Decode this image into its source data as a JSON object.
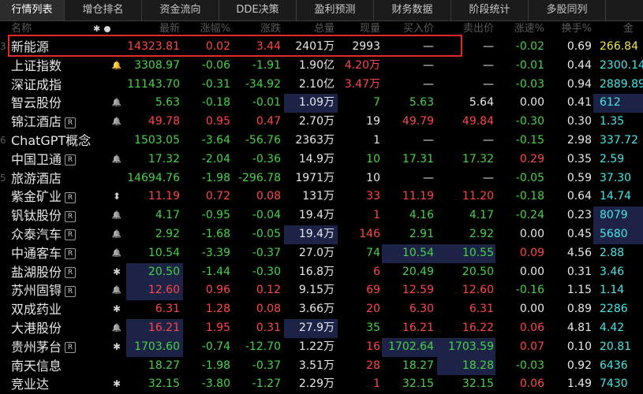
{
  "tabs": [
    "行情列表",
    "增仓排名",
    "资金流向",
    "DDE决策",
    "盈利预测",
    "财务数据",
    "阶段统计",
    "多股同列"
  ],
  "headers": [
    "名称",
    "最新",
    "涨幅%",
    "涨跌",
    "总量",
    "现量",
    "买入价",
    "卖出价",
    "涨速%",
    "换手%",
    "金"
  ],
  "rows": [
    {
      "idx": "3",
      "name": "新能源",
      "badge": "",
      "mark": "",
      "price": "14323.81",
      "pct": "0.02",
      "chg": "3.44",
      "vol": "2401万",
      "cur": "2993",
      "bid": "—",
      "ask": "—",
      "speed": "-0.02",
      "turn": "0.69",
      "amt": "266.84",
      "c": [
        "red",
        "red",
        "red",
        "white",
        "white",
        "white",
        "white",
        "green",
        "white",
        "yellow"
      ],
      "bg": []
    },
    {
      "idx": "",
      "name": "上证指数",
      "badge": "",
      "mark": "bell-red",
      "price": "3308.97",
      "pct": "-0.06",
      "chg": "-1.91",
      "vol": "1.90亿",
      "cur": "4.20万",
      "bid": "—",
      "ask": "—",
      "speed": "-0.01",
      "turn": "0.44",
      "amt": "2300.14",
      "c": [
        "green",
        "green",
        "green",
        "white",
        "red",
        "white",
        "white",
        "green",
        "white",
        "cyan"
      ],
      "bg": []
    },
    {
      "idx": "",
      "name": "深证成指",
      "badge": "",
      "mark": "",
      "price": "11143.70",
      "pct": "-0.31",
      "chg": "-34.92",
      "vol": "2.10亿",
      "cur": "3.47万",
      "bid": "—",
      "ask": "—",
      "speed": "-0.03",
      "turn": "0.94",
      "amt": "2889.89",
      "c": [
        "green",
        "green",
        "green",
        "white",
        "red",
        "white",
        "white",
        "green",
        "white",
        "cyan"
      ],
      "bg": []
    },
    {
      "idx": "",
      "name": "智云股份",
      "badge": "",
      "mark": "bell",
      "price": "5.63",
      "pct": "-0.18",
      "chg": "-0.01",
      "vol": "1.09万",
      "cur": "7",
      "bid": "5.63",
      "ask": "5.64",
      "speed": "0.00",
      "turn": "0.41",
      "amt": "612",
      "c": [
        "green",
        "green",
        "green",
        "white",
        "green",
        "green",
        "white",
        "white",
        "white",
        "cyan"
      ],
      "bg": [
        "vol",
        "amt"
      ]
    },
    {
      "idx": "",
      "name": "锦江酒店",
      "badge": "R",
      "mark": "bell",
      "price": "49.78",
      "pct": "0.95",
      "chg": "0.47",
      "vol": "2.70万",
      "cur": "19",
      "bid": "49.79",
      "ask": "49.84",
      "speed": "-0.30",
      "turn": "0.30",
      "amt": "1.35",
      "c": [
        "red",
        "red",
        "red",
        "white",
        "white",
        "red",
        "red",
        "green",
        "white",
        "cyan"
      ],
      "bg": []
    },
    {
      "idx": "6",
      "name": "ChatGPT概念",
      "badge": "",
      "mark": "",
      "price": "1503.05",
      "pct": "-3.64",
      "chg": "-56.76",
      "vol": "2363万",
      "cur": "1",
      "bid": "—",
      "ask": "—",
      "speed": "-0.15",
      "turn": "2.98",
      "amt": "337.72",
      "c": [
        "green",
        "green",
        "green",
        "white",
        "white",
        "white",
        "white",
        "green",
        "white",
        "cyan"
      ],
      "bg": []
    },
    {
      "idx": "",
      "name": "中国卫通",
      "badge": "R",
      "mark": "bell",
      "price": "17.32",
      "pct": "-2.04",
      "chg": "-0.36",
      "vol": "14.9万",
      "cur": "10",
      "bid": "17.31",
      "ask": "17.32",
      "speed": "0.29",
      "turn": "0.35",
      "amt": "2.59",
      "c": [
        "green",
        "green",
        "green",
        "white",
        "green",
        "green",
        "green",
        "red",
        "white",
        "cyan"
      ],
      "bg": []
    },
    {
      "idx": "5",
      "name": "旅游酒店",
      "badge": "",
      "mark": "",
      "price": "14694.76",
      "pct": "-1.98",
      "chg": "-296.78",
      "vol": "1971万",
      "cur": "10",
      "bid": "—",
      "ask": "—",
      "speed": "-0.05",
      "turn": "0.59",
      "amt": "37.30",
      "c": [
        "green",
        "green",
        "green",
        "white",
        "white",
        "white",
        "white",
        "green",
        "white",
        "cyan"
      ],
      "bg": []
    },
    {
      "idx": "",
      "name": "紫金矿业",
      "badge": "R",
      "mark": "updown",
      "price": "11.19",
      "pct": "0.72",
      "chg": "0.08",
      "vol": "131万",
      "cur": "33",
      "bid": "11.19",
      "ask": "11.20",
      "speed": "-0.18",
      "turn": "0.64",
      "amt": "14.74",
      "c": [
        "red",
        "red",
        "red",
        "white",
        "red",
        "red",
        "red",
        "green",
        "white",
        "cyan"
      ],
      "bg": []
    },
    {
      "idx": "",
      "name": "钒钛股份",
      "badge": "R",
      "mark": "bell",
      "price": "4.17",
      "pct": "-0.95",
      "chg": "-0.04",
      "vol": "19.4万",
      "cur": "1",
      "bid": "4.16",
      "ask": "4.17",
      "speed": "-0.24",
      "turn": "0.23",
      "amt": "8079",
      "c": [
        "green",
        "green",
        "green",
        "white",
        "red",
        "green",
        "green",
        "green",
        "white",
        "cyan"
      ],
      "bg": [
        "amt"
      ]
    },
    {
      "idx": "",
      "name": "众泰汽车",
      "badge": "R",
      "mark": "bell",
      "price": "2.92",
      "pct": "-1.68",
      "chg": "-0.05",
      "vol": "19.4万",
      "cur": "146",
      "bid": "2.91",
      "ask": "2.92",
      "speed": "0.00",
      "turn": "0.45",
      "amt": "5680",
      "c": [
        "green",
        "green",
        "green",
        "white",
        "red",
        "green",
        "green",
        "white",
        "white",
        "cyan"
      ],
      "bg": [
        "vol",
        "amt"
      ]
    },
    {
      "idx": "",
      "name": "中通客车",
      "badge": "R",
      "mark": "bell",
      "price": "10.54",
      "pct": "-3.39",
      "chg": "-0.37",
      "vol": "27.0万",
      "cur": "74",
      "bid": "10.54",
      "ask": "10.55",
      "speed": "0.09",
      "turn": "4.56",
      "amt": "2.88",
      "c": [
        "green",
        "green",
        "green",
        "white",
        "green",
        "green",
        "green",
        "red",
        "white",
        "cyan"
      ],
      "bg": [
        "bid",
        "ask"
      ]
    },
    {
      "idx": "",
      "name": "盐湖股份",
      "badge": "R",
      "mark": "star",
      "price": "20.50",
      "pct": "-1.44",
      "chg": "-0.30",
      "vol": "16.8万",
      "cur": "6",
      "bid": "20.49",
      "ask": "20.50",
      "speed": "0.00",
      "turn": "0.31",
      "amt": "3.46",
      "c": [
        "green",
        "green",
        "green",
        "white",
        "red",
        "green",
        "green",
        "white",
        "white",
        "cyan"
      ],
      "bg": [
        "price"
      ]
    },
    {
      "idx": "",
      "name": "苏州固锝",
      "badge": "R",
      "mark": "bell",
      "price": "12.60",
      "pct": "0.96",
      "chg": "0.12",
      "vol": "9.15万",
      "cur": "69",
      "bid": "12.59",
      "ask": "12.60",
      "speed": "-0.16",
      "turn": "1.15",
      "amt": "1.14",
      "c": [
        "red",
        "red",
        "red",
        "white",
        "red",
        "red",
        "red",
        "green",
        "white",
        "cyan"
      ],
      "bg": [
        "price"
      ]
    },
    {
      "idx": "",
      "name": "双成药业",
      "badge": "",
      "mark": "star",
      "price": "6.31",
      "pct": "1.28",
      "chg": "0.08",
      "vol": "3.66万",
      "cur": "20",
      "bid": "6.30",
      "ask": "6.31",
      "speed": "0.00",
      "turn": "0.89",
      "amt": "2286",
      "c": [
        "red",
        "red",
        "red",
        "white",
        "red",
        "red",
        "red",
        "white",
        "white",
        "cyan"
      ],
      "bg": []
    },
    {
      "idx": "",
      "name": "大港股份",
      "badge": "",
      "mark": "bell",
      "price": "16.21",
      "pct": "1.95",
      "chg": "0.31",
      "vol": "27.9万",
      "cur": "35",
      "bid": "16.21",
      "ask": "16.22",
      "speed": "0.06",
      "turn": "4.81",
      "amt": "4.42",
      "c": [
        "red",
        "red",
        "red",
        "white",
        "green",
        "red",
        "red",
        "red",
        "white",
        "cyan"
      ],
      "bg": [
        "price",
        "vol"
      ]
    },
    {
      "idx": "",
      "name": "贵州茅台",
      "badge": "R",
      "mark": "star",
      "price": "1703.60",
      "pct": "-0.74",
      "chg": "-12.70",
      "vol": "1.22万",
      "cur": "16",
      "bid": "1702.64",
      "ask": "1703.59",
      "speed": "0.07",
      "turn": "0.10",
      "amt": "20.81",
      "c": [
        "green",
        "green",
        "green",
        "white",
        "red",
        "green",
        "green",
        "red",
        "white",
        "cyan"
      ],
      "bg": [
        "price",
        "bid",
        "ask"
      ]
    },
    {
      "idx": "",
      "name": "南天信息",
      "badge": "",
      "mark": "",
      "price": "18.27",
      "pct": "-1.98",
      "chg": "-0.37",
      "vol": "3.51万",
      "cur": "28",
      "bid": "18.27",
      "ask": "18.28",
      "speed": "-0.03",
      "turn": "0.92",
      "amt": "6436",
      "c": [
        "green",
        "green",
        "green",
        "white",
        "red",
        "green",
        "green",
        "green",
        "white",
        "cyan"
      ],
      "bg": [
        "ask"
      ]
    },
    {
      "idx": "",
      "name": "竞业达",
      "badge": "",
      "mark": "star",
      "price": "32.15",
      "pct": "-3.80",
      "chg": "-1.27",
      "vol": "2.29万",
      "cur": "1",
      "bid": "32.15",
      "ask": "32.15",
      "speed": "0.06",
      "turn": "1.49",
      "amt": "7430",
      "c": [
        "green",
        "green",
        "green",
        "white",
        "red",
        "green",
        "green",
        "red",
        "white",
        "cyan"
      ],
      "bg": []
    }
  ]
}
